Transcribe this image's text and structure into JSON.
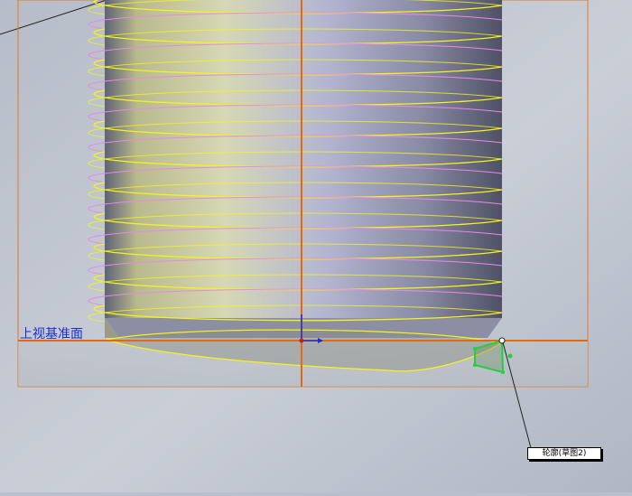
{
  "viewport": {
    "plane_label": "上视基准面",
    "callout_label": "轮廓(草图2)",
    "colors": {
      "background": "#b9c0cb",
      "plane_border": "#e07a2a",
      "axis": "#e46a12",
      "helix_front": "#f4f41a",
      "helix_back": "#e68ae6",
      "profile": "#22d03a",
      "origin": "#1a2fd0"
    }
  }
}
